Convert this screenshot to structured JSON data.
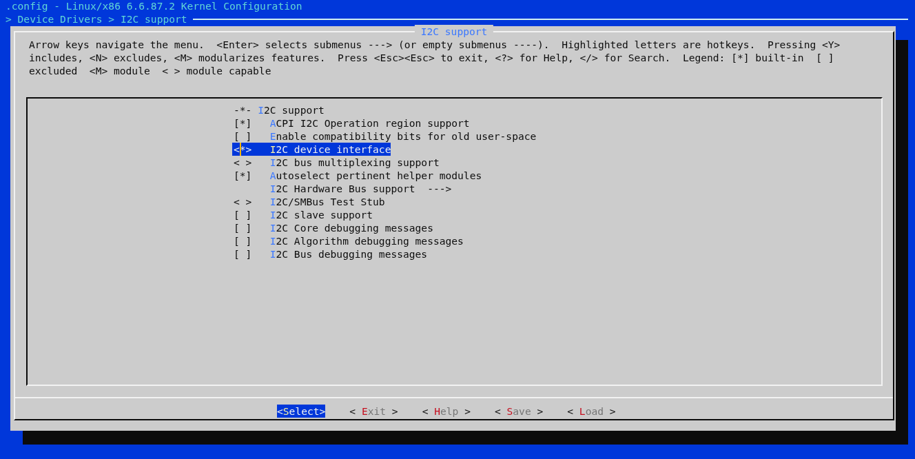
{
  "window": {
    "title": ".config - Linux/x86 6.6.87.2 Kernel Configuration"
  },
  "breadcrumb": "> Device Drivers > I2C support",
  "dialog": {
    "title": "I2C support",
    "help": "Arrow keys navigate the menu.  <Enter> selects submenus ---> (or empty submenus ----).  Highlighted letters are hotkeys.  Pressing <Y> includes, <N> excludes, <M> modularizes features.  Press <Esc><Esc> to exit, <?> for Help, </> for Search.  Legend: [*] built-in  [ ] excluded  <M> module  < > module capable"
  },
  "menu": {
    "items": [
      {
        "kind": "header",
        "status": "-*-",
        "label": "I2C support",
        "selected": false
      },
      {
        "kind": "option",
        "status": "[*]",
        "label": "ACPI I2C Operation region support",
        "selected": false
      },
      {
        "kind": "option",
        "status": "[ ]",
        "label": "Enable compatibility bits for old user-space",
        "selected": false
      },
      {
        "kind": "option",
        "status": "<*>",
        "label": "I2C device interface",
        "selected": true
      },
      {
        "kind": "option",
        "status": "< >",
        "label": "I2C bus multiplexing support",
        "selected": false
      },
      {
        "kind": "option",
        "status": "[*]",
        "label": "Autoselect pertinent helper modules",
        "selected": false
      },
      {
        "kind": "submenu",
        "label": "I2C Hardware Bus support  --->",
        "selected": false
      },
      {
        "kind": "option",
        "status": "< >",
        "label": "I2C/SMBus Test Stub",
        "selected": false
      },
      {
        "kind": "option",
        "status": "[ ]",
        "label": "I2C slave support",
        "selected": false
      },
      {
        "kind": "option",
        "status": "[ ]",
        "label": "I2C Core debugging messages",
        "selected": false
      },
      {
        "kind": "option",
        "status": "[ ]",
        "label": "I2C Algorithm debugging messages",
        "selected": false
      },
      {
        "kind": "option",
        "status": "[ ]",
        "label": "I2C Bus debugging messages",
        "selected": false
      }
    ]
  },
  "buttons": [
    {
      "label": "<Select>",
      "selected": true
    },
    {
      "label": "< Exit >",
      "selected": false
    },
    {
      "label": "< Help >",
      "selected": false
    },
    {
      "label": "< Save >",
      "selected": false
    },
    {
      "label": "< Load >",
      "selected": false
    }
  ]
}
